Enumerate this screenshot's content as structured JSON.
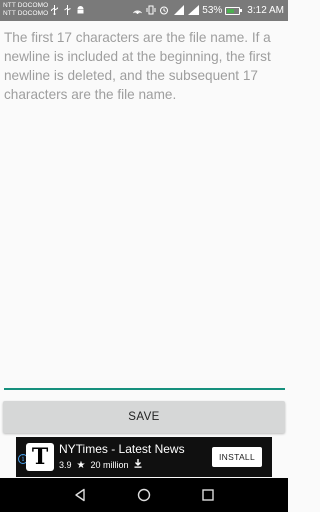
{
  "status_bar": {
    "carrier_line1": "NTT DOCOMO",
    "carrier_line2": "NTT DOCOMO",
    "battery_percent": "53%",
    "battery_level": 0.53,
    "time": "3:12 AM"
  },
  "editor": {
    "text": "The first 17 characters are the file name. If a newline is included at the beginning, the first newline is deleted, and the subsequent 17 characters are the file name.",
    "underline_color": "#16907d"
  },
  "save_button": {
    "label": "SAVE"
  },
  "ad": {
    "app_icon_letter": "T",
    "title": "NYTimes - Latest News",
    "rating": "3.9",
    "downloads": "20 million",
    "install_label": "INSTALL",
    "info_glyph": "i"
  },
  "colors": {
    "status_bar": "#7a7a7a",
    "accent": "#16907d",
    "button": "#d6d7d7",
    "ad_background": "#101010"
  }
}
